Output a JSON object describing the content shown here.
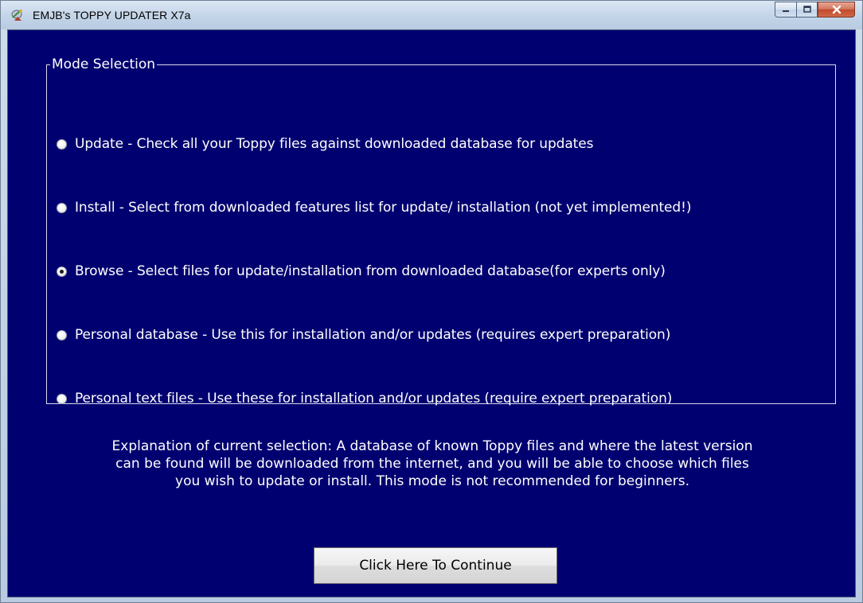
{
  "window": {
    "title": "EMJB's TOPPY UPDATER X7a",
    "icon": "satellite-dish-icon",
    "caption_buttons": [
      "minimize-icon",
      "maximize-icon",
      "close-icon"
    ]
  },
  "mode_selection": {
    "legend": "Mode Selection",
    "selected_index": 2,
    "options": [
      {
        "label": "Update - Check all your Toppy files against downloaded database for updates",
        "checked": false
      },
      {
        "label": "Install - Select from downloaded features list for update/ installation (not  yet implemented!)",
        "checked": false
      },
      {
        "label": "Browse - Select files for update/installation from downloaded database(for experts only)",
        "checked": true
      },
      {
        "label": "Personal database - Use this for installation and/or updates (requires expert preparation)",
        "checked": false
      },
      {
        "label": "Personal text files - Use these for installation and/or updates (require expert preparation)",
        "checked": false
      }
    ]
  },
  "explanation": {
    "line1": "Explanation of current selection: A database of known Toppy files and where the latest version",
    "line2": "can be found will be downloaded from the internet, and you will be able to choose which files",
    "line3": "you wish to update or install. This mode is not recommended for beginners."
  },
  "continue_button": {
    "label": "Click Here To Continue"
  },
  "colors": {
    "client_background": "#000070",
    "text": "#ffffff",
    "close_button": "#c24a2c"
  }
}
